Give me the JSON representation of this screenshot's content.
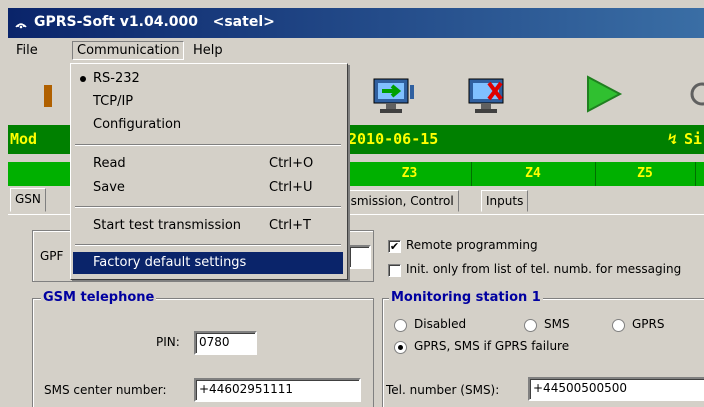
{
  "window": {
    "title": "GPRS-Soft v1.04.000   <satel>"
  },
  "menubar": {
    "items": [
      "File",
      "Communication",
      "Help"
    ]
  },
  "communication_menu": {
    "items": [
      {
        "label": "RS-232",
        "shortcut": "",
        "checked": true
      },
      {
        "label": "TCP/IP",
        "shortcut": "",
        "checked": false
      },
      {
        "label": "Configuration",
        "shortcut": "",
        "checked": false
      },
      {
        "label": "Read",
        "shortcut": "Ctrl+O",
        "checked": false
      },
      {
        "label": "Save",
        "shortcut": "Ctrl+U",
        "checked": false
      },
      {
        "label": "Start test transmission",
        "shortcut": "Ctrl+T",
        "checked": false
      },
      {
        "label": "Factory default settings",
        "shortcut": "",
        "checked": false,
        "highlighted": true
      }
    ]
  },
  "status_bar": {
    "module_prefix": "Mod",
    "date": "2010-06-15",
    "signal_prefix": "Si"
  },
  "zones": [
    "Z3",
    "Z4",
    "Z5"
  ],
  "tabs": [
    "GSN",
    "nsmission, Control",
    "Inputs"
  ],
  "gprs_row": {
    "label": "GPF"
  },
  "options": {
    "remote_programming": {
      "label": "Remote programming",
      "checked": true
    },
    "init_only": {
      "label": "Init. only from list of tel. numb. for messaging",
      "checked": false
    }
  },
  "gsm_telephone": {
    "title": "GSM telephone",
    "pin_label": "PIN:",
    "pin_value": "0780",
    "sms_center_label": "SMS center number:",
    "sms_center_value": "+44602951111"
  },
  "monitoring_station": {
    "title": "Monitoring station 1",
    "options": [
      "Disabled",
      "SMS",
      "GPRS",
      "GPRS, SMS if GPRS failure"
    ],
    "selected": "GPRS, SMS if GPRS failure",
    "tel_label": "Tel. number (SMS):",
    "tel_value": "+44500500500"
  },
  "colors": {
    "title_bar": "#0a246a",
    "status_green": "#008000",
    "zone_green": "#00b000",
    "status_text": "#ffff00",
    "group_title": "#0000a0",
    "highlight": "#0a246a"
  }
}
